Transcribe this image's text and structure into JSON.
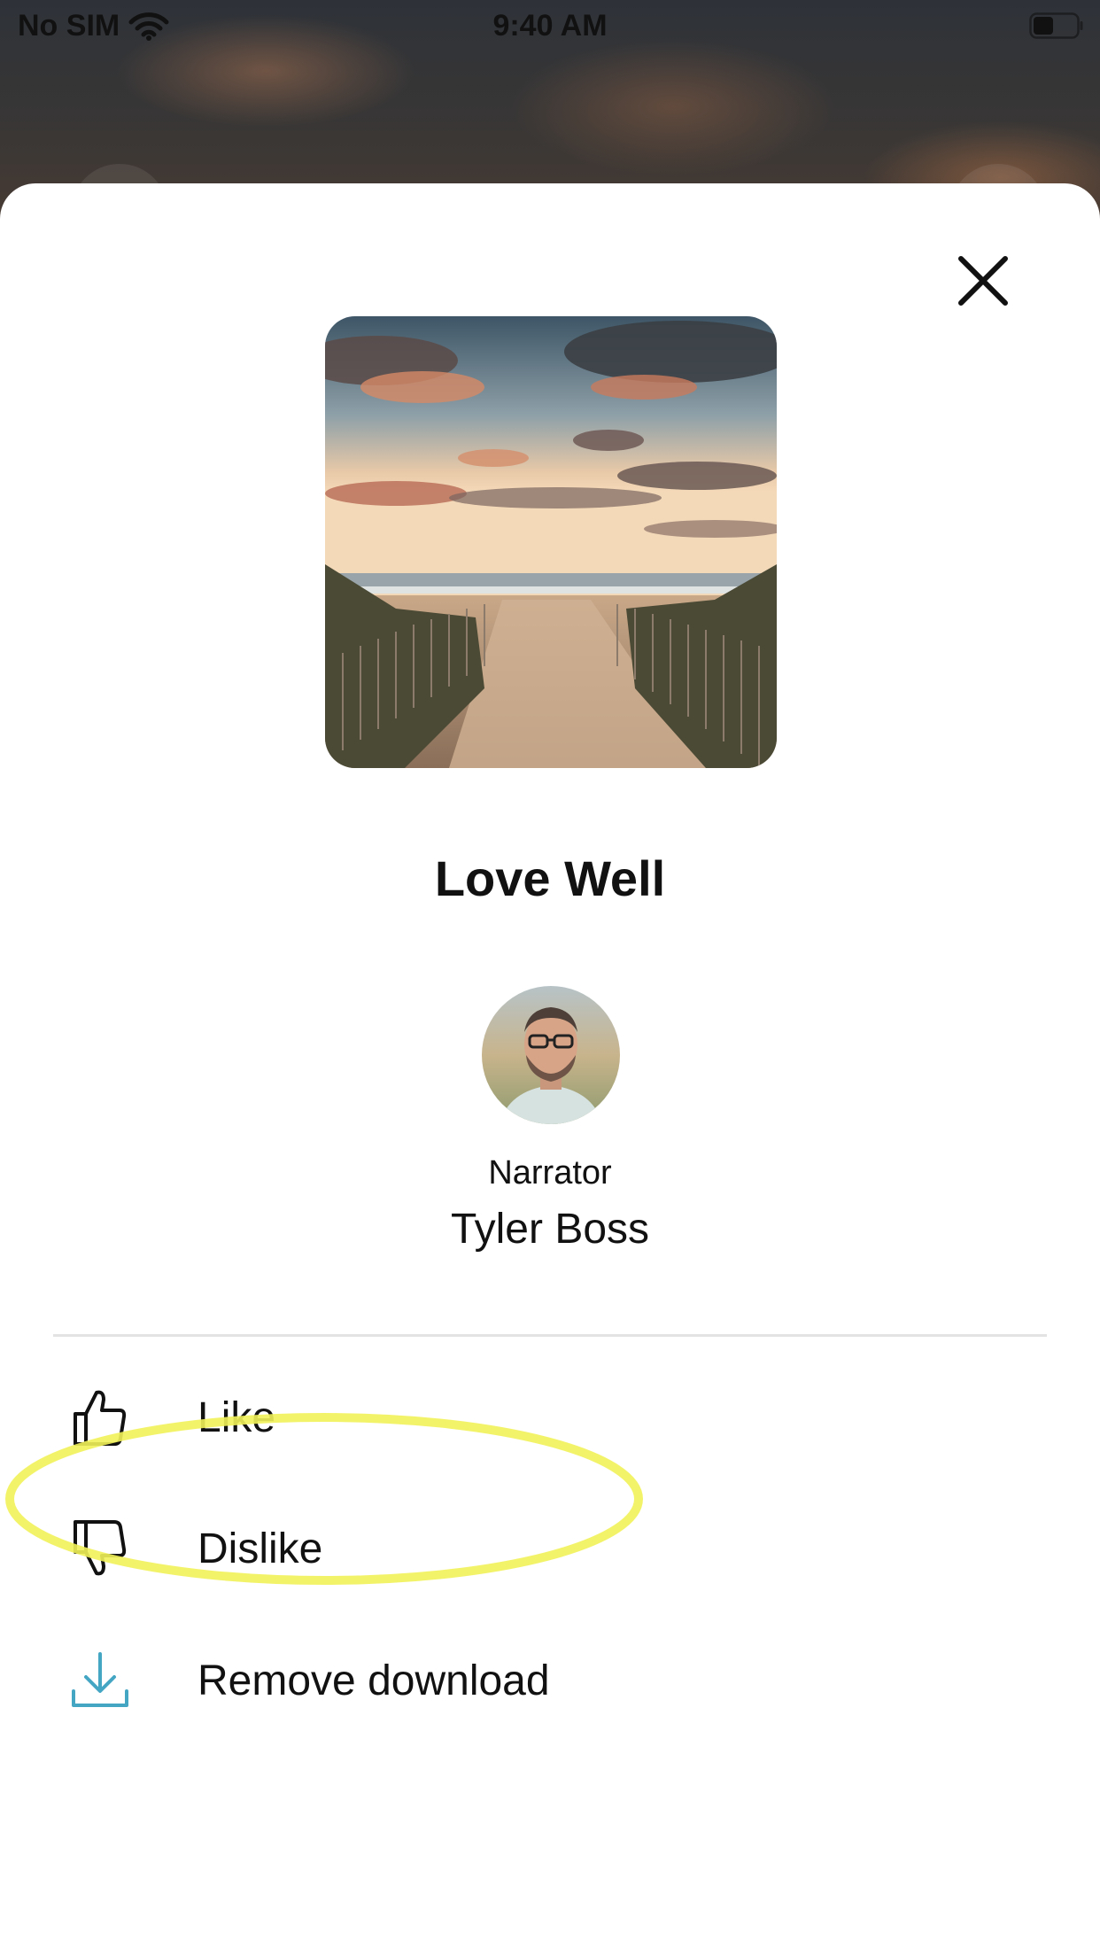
{
  "status_bar": {
    "carrier": "No SIM",
    "time": "9:40 AM"
  },
  "sheet": {
    "title": "Love Well",
    "narrator_label": "Narrator",
    "narrator_name": "Tyler Boss",
    "menu": [
      {
        "label": "Like",
        "icon": "thumbs-up-icon"
      },
      {
        "label": "Dislike",
        "icon": "thumbs-down-icon"
      },
      {
        "label": "Remove download",
        "icon": "download-icon"
      }
    ]
  },
  "colors": {
    "download_icon": "#45a6c4",
    "highlight": "#f2f25a",
    "text": "#111111"
  }
}
